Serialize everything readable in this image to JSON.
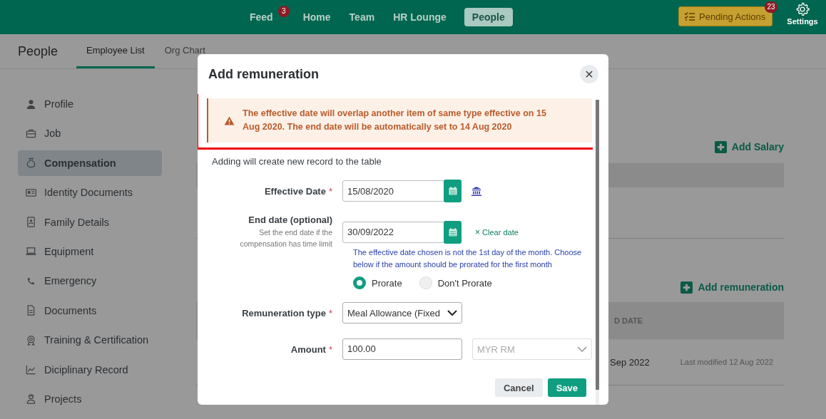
{
  "top_nav": {
    "items": [
      {
        "label": "Feed",
        "badge": "3",
        "selected": false
      },
      {
        "label": "Home",
        "selected": false
      },
      {
        "label": "Team",
        "selected": false
      },
      {
        "label": "HR Lounge",
        "selected": false
      },
      {
        "label": "People",
        "selected": true
      }
    ],
    "pending_actions": {
      "label": "Pending Actions",
      "badge": "23"
    },
    "settings": {
      "label": "Settings"
    }
  },
  "subheader": {
    "title": "People",
    "tabs": [
      {
        "label": "Employee List",
        "selected": true
      },
      {
        "label": "Org Chart",
        "selected": false
      }
    ]
  },
  "sidebar": {
    "items": [
      {
        "label": "Profile",
        "selected": false
      },
      {
        "label": "Job",
        "selected": false
      },
      {
        "label": "Compensation",
        "selected": true
      },
      {
        "label": "Identity Documents",
        "selected": false
      },
      {
        "label": "Family Details",
        "selected": false
      },
      {
        "label": "Equipment",
        "selected": false
      },
      {
        "label": "Emergency",
        "selected": false
      },
      {
        "label": "Documents",
        "selected": false
      },
      {
        "label": "Training & Certification",
        "selected": false
      },
      {
        "label": "Diciplinary Record",
        "selected": false
      },
      {
        "label": "Projects",
        "selected": false
      }
    ]
  },
  "background": {
    "add_salary": "Add Salary",
    "add_remuneration": "Add remuneration",
    "table_header": "D DATE",
    "row": {
      "end_date": "Sep 2022",
      "modified": "Last modified 12 Aug 2022"
    }
  },
  "dialog": {
    "title": "Add remuneration",
    "close": "✕",
    "warning": "The effective date will overlap another item of same type effective on 15 Aug 2020. The end date will be automatically set to 14 Aug 2020",
    "intro": "Adding will create new record to the table",
    "effective_date": {
      "label": "Effective Date",
      "mark": "*",
      "value": "15/08/2020"
    },
    "end_date": {
      "label": "End date (optional)",
      "hint": "Set the end date if the compensation has time limit",
      "value": "30/09/2022",
      "clear_icon": "×",
      "clear": "Clear date"
    },
    "proration_note": "The effective date chosen is not the 1st day of the month. Choose below if the amount should be prorated for the first month",
    "proration": [
      {
        "label": "Prorate",
        "selected": true
      },
      {
        "label": "Don't Prorate",
        "selected": false
      }
    ],
    "remuneration_type": {
      "label": "Remuneration type",
      "mark": "*",
      "value": "Meal Allowance (Fixed"
    },
    "amount": {
      "label": "Amount",
      "mark": "*",
      "value": "100.00"
    },
    "currency": {
      "value": "MYR RM",
      "disabled": true
    },
    "buttons": [
      {
        "label": "Cancel",
        "kind": "secondary"
      },
      {
        "label": "Save",
        "kind": "primary"
      }
    ]
  }
}
